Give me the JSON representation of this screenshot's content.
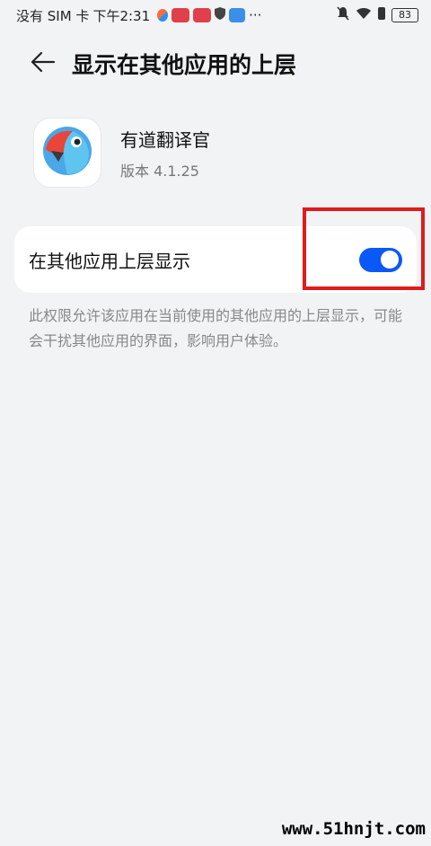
{
  "status_bar": {
    "carrier": "没有 SIM 卡",
    "time": "下午2:31",
    "more": "···",
    "battery": "83"
  },
  "header": {
    "back_icon": "back-arrow-icon",
    "title": "显示在其他应用的上层"
  },
  "app": {
    "name": "有道翻译官",
    "version": "版本 4.1.25",
    "icon": "youdao-parrot-icon"
  },
  "setting": {
    "label": "在其他应用上层显示",
    "enabled": true,
    "toggle_color": "#0a59f7"
  },
  "description": "此权限允许该应用在当前使用的其他应用的上层显示，可能会干扰其他应用的界面，影响用户体验。",
  "watermark": "www.51hnjt.com",
  "colors": {
    "background": "#f1f3f5",
    "highlight": "#e01b1b"
  }
}
